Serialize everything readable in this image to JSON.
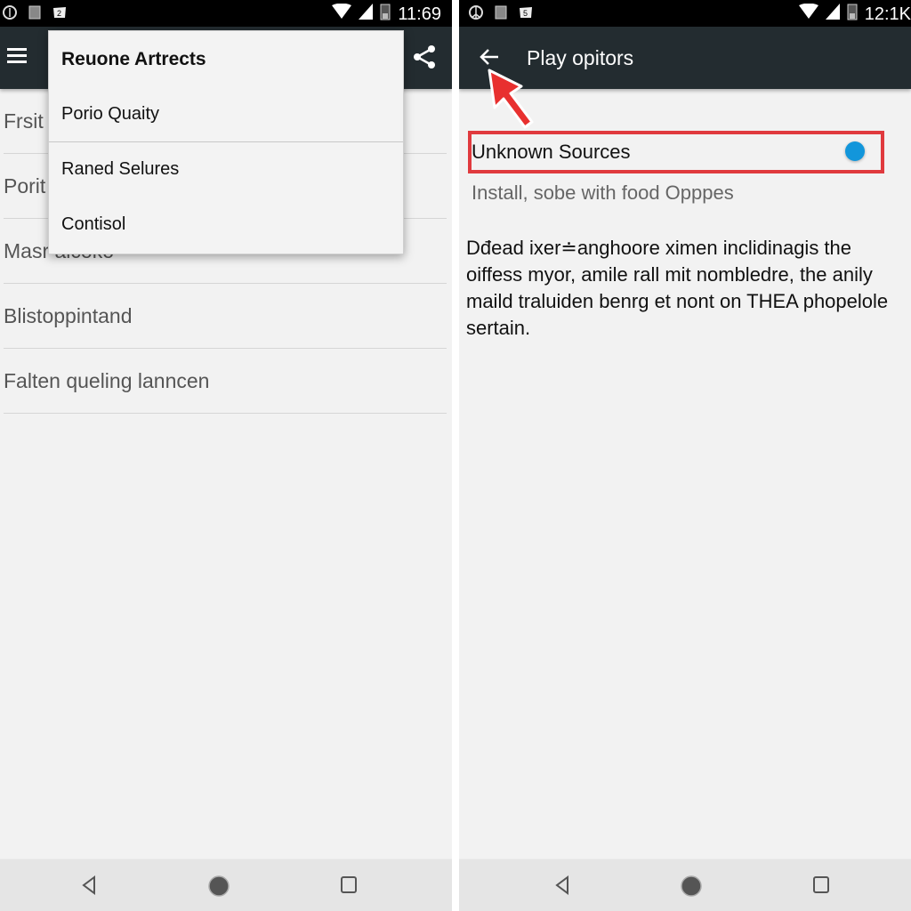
{
  "left_screen": {
    "status_bar": {
      "left_icons": [
        "sync-icon",
        "sim-icon",
        "notification-icon"
      ],
      "time": "11:69",
      "right_icons": [
        "wifi-icon",
        "signal-icon",
        "battery-icon"
      ]
    },
    "toolbar": {
      "menu_icon": "hamburger-icon",
      "share_icon": "share-icon"
    },
    "list_items": [
      {
        "label": "Frsit"
      },
      {
        "label": "Porit"
      },
      {
        "label": "Masr aicoko"
      },
      {
        "label": "Blistoppintand"
      },
      {
        "label": "Falten queling lanncen"
      }
    ],
    "popup_menu": {
      "title": "Reuone Artrects",
      "items": [
        {
          "label": "Porio Quaity"
        },
        {
          "label": "Raned Selures"
        },
        {
          "label": "Contisol"
        }
      ]
    },
    "nav_bar": {
      "back": "back-triangle-icon",
      "home": "home-circle-icon",
      "recents": "recents-square-icon"
    }
  },
  "right_screen": {
    "status_bar": {
      "left_icons": [
        "peace-icon",
        "sim-icon",
        "notification-icon"
      ],
      "time": "12:1K",
      "right_icons": [
        "wifi-icon",
        "signal-icon",
        "battery-icon"
      ]
    },
    "toolbar": {
      "back_icon": "back-arrow-icon",
      "title": "Play opitors"
    },
    "setting": {
      "label": "Unknown Sources",
      "toggle_on": true,
      "subtitle": "Install, sobe with food Opppes"
    },
    "description": "Dđead ixer≐anghoore ximen inclidinagis the oiffess myor, amile rall mit nombledre, the anily maild traluiden benrg et nont on THEA phopelole sertain.",
    "annotation": {
      "highlight_color": "#e03a3e",
      "pointer": "red-cursor-arrow"
    },
    "nav_bar": {
      "back": "back-triangle-icon",
      "home": "home-circle-icon",
      "recents": "recents-square-icon"
    }
  },
  "colors": {
    "toolbar": "#232c30",
    "status_bar": "#000000",
    "background": "#f2f2f2",
    "toggle": "#1296db",
    "highlight": "#e03a3e"
  }
}
